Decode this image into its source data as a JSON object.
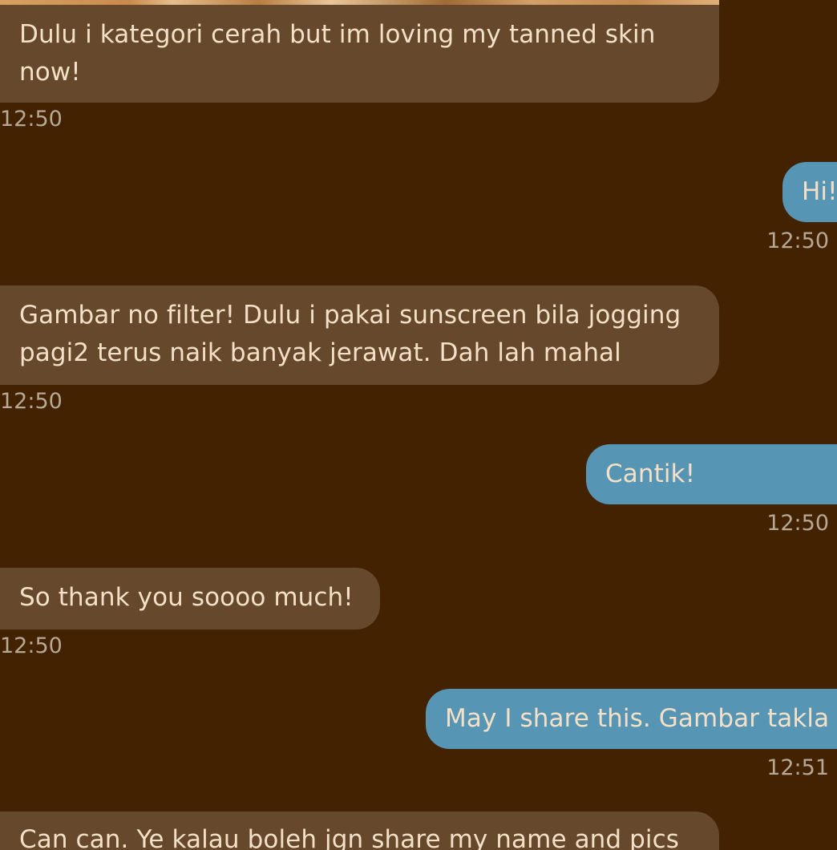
{
  "theme": {
    "background": "#422201",
    "incoming_bubble": "#66482c",
    "outgoing_bubble": "#5795b4",
    "message_text": "#f4e0c6",
    "timestamp_text": "#b6a894"
  },
  "messages": [
    {
      "direction": "incoming",
      "lines": [
        "Dulu i kategori cerah but im loving my tanned skin",
        "now!"
      ],
      "time": "12:50"
    },
    {
      "direction": "outgoing",
      "lines": [
        "Hi!"
      ],
      "time": "12:50"
    },
    {
      "direction": "incoming",
      "lines": [
        "Gambar no filter! Dulu i pakai sunscreen bila jogging",
        "pagi2 terus naik banyak jerawat. Dah lah mahal"
      ],
      "time": "12:50"
    },
    {
      "direction": "outgoing",
      "lines": [
        "Cantik!"
      ],
      "time": "12:50"
    },
    {
      "direction": "incoming",
      "lines": [
        "So thank you soooo much!"
      ],
      "time": "12:50"
    },
    {
      "direction": "outgoing",
      "lines": [
        "May I share this. Gambar takla"
      ],
      "time": "12:51"
    },
    {
      "direction": "incoming",
      "lines": [
        "Can can. Ye kalau boleh jgn share my name and pics"
      ],
      "time": ""
    }
  ]
}
